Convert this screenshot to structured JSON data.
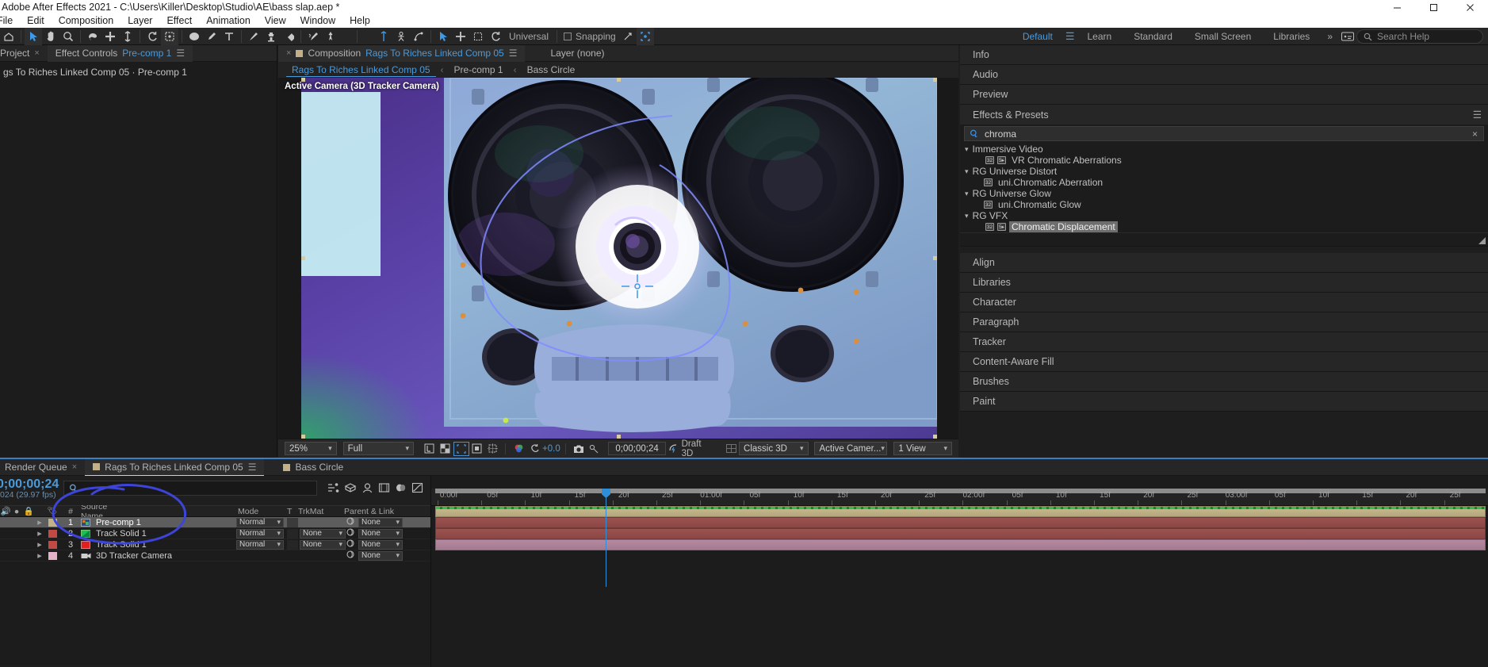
{
  "window": {
    "title": "Adobe After Effects 2021 - C:\\Users\\Killer\\Desktop\\Studio\\AE\\bass slap.aep *",
    "minimize": "minimize-icon",
    "maximize": "maximize-icon",
    "close": "close-icon"
  },
  "menu": {
    "items": [
      "File",
      "Edit",
      "Composition",
      "Layer",
      "Effect",
      "Animation",
      "View",
      "Window",
      "Help"
    ]
  },
  "toolbar": {
    "universal_label": "Universal",
    "snapping_label": "Snapping",
    "workspaces": [
      "Default",
      "Learn",
      "Standard",
      "Small Screen",
      "Libraries"
    ],
    "active_workspace": "Default",
    "overflow": "»",
    "search_placeholder": "Search Help",
    "tools": [
      "home-icon",
      "selection-tool-icon",
      "hand-tool-icon",
      "zoom-tool-icon",
      "rotation-tool-icon",
      "anchor-point-tool-icon",
      "pan-behind-tool-icon",
      "rotation-alt-icon",
      "region-of-interest-icon",
      "shape-tool-icon",
      "pen-tool-icon",
      "type-tool-icon",
      "brush-tool-icon",
      "clone-stamp-tool-icon",
      "eraser-tool-icon",
      "roto-brush-tool-icon",
      "puppet-pin-tool-icon"
    ]
  },
  "effect_controls": {
    "tab_label": "Effect Controls",
    "tab_target": "Pre-comp 1",
    "close_icon": "close-icon",
    "menu_icon": "panel-menu-icon",
    "header": "gs To Riches Linked Comp 05 · Pre-comp 1"
  },
  "composition": {
    "tab_label": "Composition",
    "tab_name": "Rags To Riches Linked Comp 05",
    "layer_tab": "Layer (none)",
    "close_icon": "close-icon",
    "menu_icon": "panel-menu-icon",
    "breadcrumb": [
      "Rags To Riches Linked Comp 05",
      "Pre-comp 1",
      "Bass Circle"
    ],
    "viewer_label": "Active Camera (3D Tracker Camera)",
    "bottom_bar": {
      "zoom": "25%",
      "resolution": "Full",
      "exposure": "+0.0",
      "timecode": "0;00;00;24",
      "draft3d": "Draft 3D",
      "renderer": "Classic 3D",
      "camera": "Active Camer...",
      "views": "1 View"
    }
  },
  "right_panels": {
    "collapsed_top": [
      "Info",
      "Audio",
      "Preview"
    ],
    "effects_presets": {
      "title": "Effects & Presets",
      "search_icon": "search-icon",
      "search_value": "chroma",
      "clear_icon": "clear-icon",
      "groups": [
        {
          "name": "Immersive Video",
          "items": [
            {
              "label": "VR Chromatic Aberrations",
              "badges": [
                "32",
                "5"
              ],
              "selected": false
            }
          ]
        },
        {
          "name": "RG Universe Distort",
          "items": [
            {
              "label": "uni.Chromatic Aberration",
              "badges": [
                "32"
              ],
              "selected": false
            }
          ]
        },
        {
          "name": "RG Universe Glow",
          "items": [
            {
              "label": "uni.Chromatic Glow",
              "badges": [
                "32"
              ],
              "selected": false
            }
          ]
        },
        {
          "name": "RG VFX",
          "items": [
            {
              "label": "Chromatic Displacement",
              "badges": [
                "32",
                "5"
              ],
              "selected": true
            }
          ]
        }
      ]
    },
    "collapsed_bottom": [
      "Align",
      "Libraries",
      "Character",
      "Paragraph",
      "Tracker",
      "Content-Aware Fill",
      "Brushes",
      "Paint"
    ]
  },
  "timeline": {
    "tabs": [
      {
        "label": "Render Queue",
        "active": false,
        "swatch": false
      },
      {
        "label": "Rags To Riches Linked Comp 05",
        "active": true,
        "swatch": true
      },
      {
        "label": "Bass Circle",
        "active": false,
        "swatch": true
      }
    ],
    "timecode": "0;00;00;24",
    "timecode_sub": "024 (29.97 fps)",
    "search_icon": "search-icon",
    "columns": [
      "Source Name",
      "Mode",
      "T",
      "TrkMat",
      "Parent & Link"
    ],
    "layers": [
      {
        "num": "1",
        "name": "Pre-comp 1",
        "mode": "Normal",
        "trkmat": "",
        "parent": "None",
        "color": "#c3b086",
        "selected": true,
        "icon": "precomp-icon"
      },
      {
        "num": "2",
        "name": "Track Solid 1",
        "mode": "Normal",
        "trkmat": "None",
        "parent": "None",
        "color": "#c24a45",
        "selected": false,
        "icon": "solid-green-icon"
      },
      {
        "num": "3",
        "name": "Track Solid 1",
        "mode": "Normal",
        "trkmat": "None",
        "parent": "None",
        "color": "#c24a45",
        "selected": false,
        "icon": "solid-red-icon"
      },
      {
        "num": "4",
        "name": "3D Tracker Camera",
        "mode": "",
        "trkmat": "",
        "parent": "None",
        "color": "#e3b2c6",
        "selected": false,
        "icon": "camera-icon"
      }
    ],
    "ruler_labels": [
      "0:00f",
      "05f",
      "10f",
      "15f",
      "20f",
      "25f",
      "01:00f",
      "05f",
      "10f",
      "15f",
      "20f",
      "25f",
      "02:00f",
      "05f",
      "10f",
      "15f",
      "20f",
      "25f",
      "03:00f",
      "05f",
      "10f",
      "15f",
      "20f",
      "25f"
    ]
  }
}
